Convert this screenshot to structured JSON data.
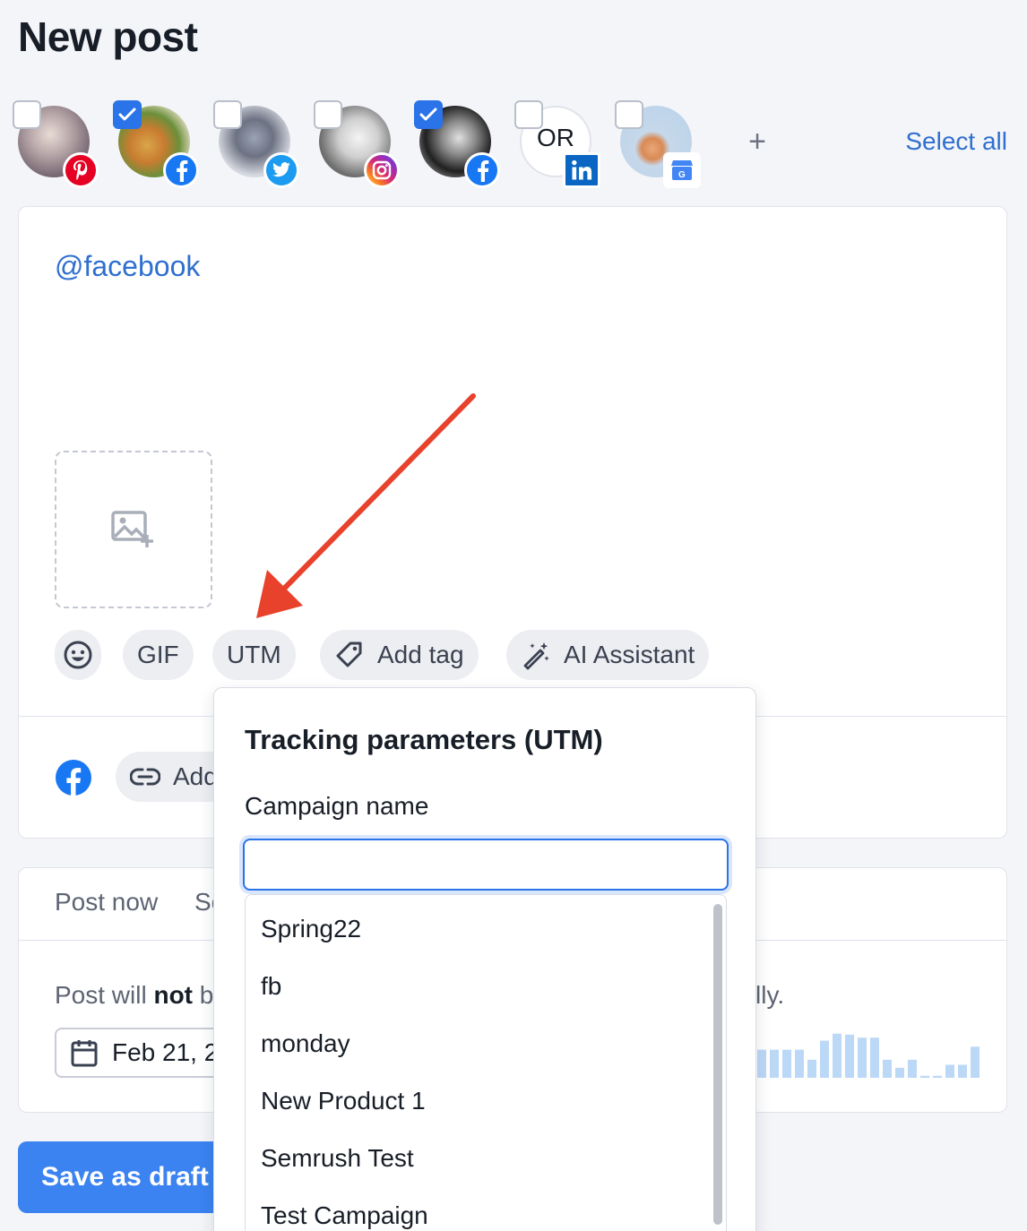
{
  "page": {
    "title": "New post"
  },
  "accounts": [
    {
      "network": "pinterest",
      "checked": false,
      "badge_color": "#e60023",
      "avatar_initials": ""
    },
    {
      "network": "facebook",
      "checked": true,
      "badge_color": "#1877f2",
      "avatar_initials": ""
    },
    {
      "network": "twitter",
      "checked": false,
      "badge_color": "#1d9bf0",
      "avatar_initials": ""
    },
    {
      "network": "instagram",
      "checked": false,
      "badge_color": "#d62976",
      "avatar_initials": ""
    },
    {
      "network": "facebook",
      "checked": true,
      "badge_color": "#1877f2",
      "avatar_initials": ""
    },
    {
      "network": "linkedin",
      "checked": false,
      "badge_color": "#0a66c2",
      "avatar_initials": "OR"
    },
    {
      "network": "google-business",
      "checked": false,
      "badge_color": "#4285f4",
      "avatar_initials": ""
    }
  ],
  "account_actions": {
    "add": "+",
    "select_all": "Select all"
  },
  "composer": {
    "text": "@facebook",
    "toolbar": {
      "gif": "GIF",
      "utm": "UTM",
      "add_tag": "Add tag",
      "ai_assistant": "AI Assistant"
    },
    "add_link_label": "Add"
  },
  "schedule": {
    "tab_post_now": "Post now",
    "tab_schedule_partial": "Sc",
    "note_prefix": "Post will ",
    "note_bold": "not",
    "note_visible_tail": "b",
    "note_end": "lly.",
    "date_value": "Feb 21, 2"
  },
  "activity_bars": [
    0.56,
    0.56,
    0.56,
    0.56,
    0.36,
    0.74,
    0.88,
    0.86,
    0.8,
    0.8,
    0.36,
    0.2,
    0.36,
    0.04,
    0.04,
    0.26,
    0.26,
    0.62,
    0.36
  ],
  "primary_button": {
    "label": "Save as draft"
  },
  "utm_popover": {
    "title": "Tracking parameters (UTM)",
    "campaign_label": "Campaign name",
    "campaign_value": "",
    "suggestions": [
      "Spring22",
      "fb",
      "monday",
      "New Product 1",
      "Semrush Test",
      "Test Campaign"
    ]
  },
  "colors": {
    "accent": "#2a73e8",
    "link": "#2f6fcf",
    "annotation_arrow": "#e8412c"
  }
}
